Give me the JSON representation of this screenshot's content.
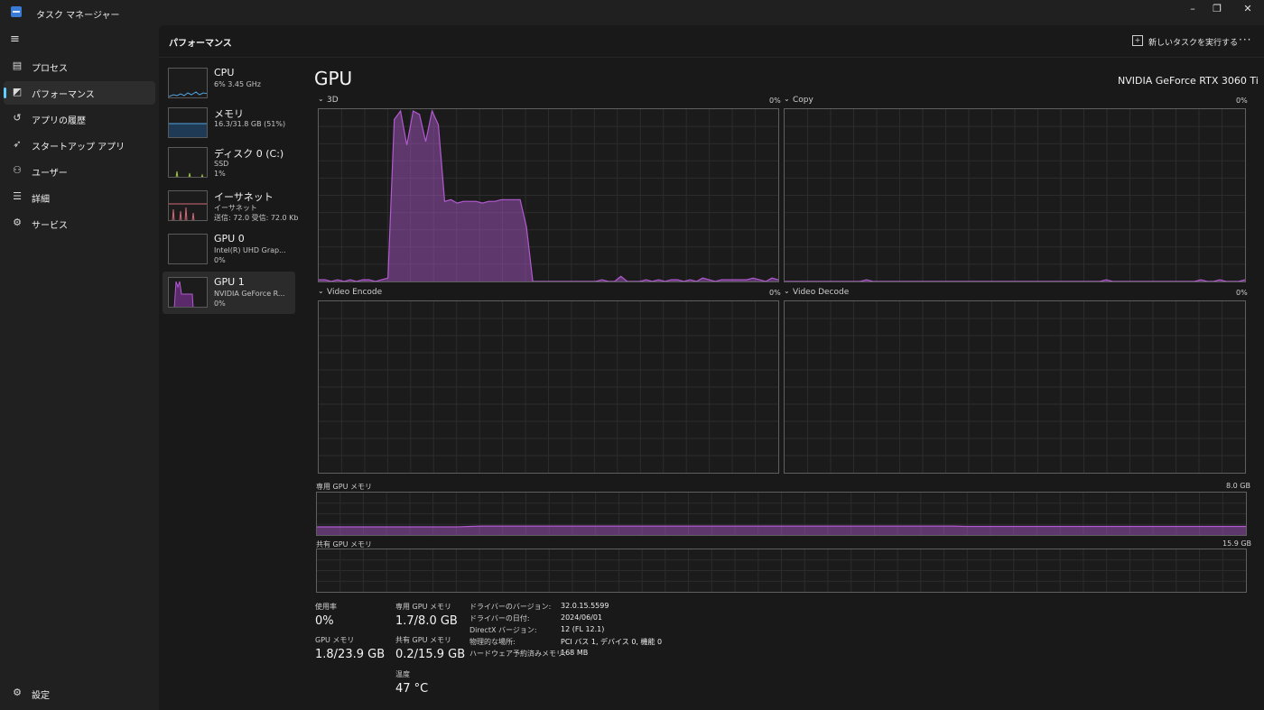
{
  "window": {
    "title": "タスク マネージャー",
    "controls": {
      "minimize": "–",
      "maximize": "❐",
      "close": "✕"
    }
  },
  "sidebar": {
    "items": [
      {
        "label": "プロセス",
        "icon": "process-icon"
      },
      {
        "label": "パフォーマンス",
        "icon": "performance-icon",
        "active": true
      },
      {
        "label": "アプリの履歴",
        "icon": "history-icon"
      },
      {
        "label": "スタートアップ アプリ",
        "icon": "startup-icon"
      },
      {
        "label": "ユーザー",
        "icon": "users-icon"
      },
      {
        "label": "詳細",
        "icon": "details-icon"
      },
      {
        "label": "サービス",
        "icon": "services-icon"
      }
    ],
    "settings_label": "設定"
  },
  "header": {
    "title": "パフォーマンス",
    "run_task_label": "新しいタスクを実行する",
    "more_label": "···"
  },
  "devices": [
    {
      "name": "CPU",
      "sub1": "6%  3.45 GHz",
      "sub2": "",
      "color": "#4fa3e0"
    },
    {
      "name": "メモリ",
      "sub1": "16.3/31.8 GB (51%)",
      "sub2": "",
      "color": "#4fa3e0"
    },
    {
      "name": "ディスク 0 (C:)",
      "sub1": "SSD",
      "sub2": "1%",
      "color": "#9bc93b"
    },
    {
      "name": "イーサネット",
      "sub1": "イーサネット",
      "sub2": "送信: 72.0  受信: 72.0 Kb",
      "color": "#d46a7a"
    },
    {
      "name": "GPU 0",
      "sub1": "Intel(R) UHD Grap...",
      "sub2": "0%",
      "color": "#b25ad1"
    },
    {
      "name": "GPU 1",
      "sub1": "NVIDIA GeForce R...",
      "sub2": "0%",
      "color": "#b25ad1",
      "active": true
    }
  ],
  "gpu": {
    "title": "GPU",
    "model": "NVIDIA GeForce RTX 3060 Ti",
    "accent": "#b25ad1",
    "engines": [
      {
        "label": "3D",
        "pct": "0%"
      },
      {
        "label": "Copy",
        "pct": "0%"
      },
      {
        "label": "Video Encode",
        "pct": "0%"
      },
      {
        "label": "Video Decode",
        "pct": "0%"
      }
    ],
    "dedicated_label": "専用 GPU メモリ",
    "dedicated_max": "8.0 GB",
    "shared_label": "共有 GPU メモリ",
    "shared_max": "15.9 GB"
  },
  "stats": {
    "usage_label": "使用率",
    "usage_value": "0%",
    "gpu_mem_label": "GPU メモリ",
    "gpu_mem_value": "1.8/23.9 GB",
    "dedicated_label": "専用 GPU メモリ",
    "dedicated_value": "1.7/8.0 GB",
    "shared_label": "共有 GPU メモリ",
    "shared_value": "0.2/15.9 GB",
    "temp_label": "温度",
    "temp_value": "47 °C"
  },
  "details": [
    {
      "key": "ドライバーのバージョン:",
      "value": "32.0.15.5599"
    },
    {
      "key": "ドライバーの日付:",
      "value": "2024/06/01"
    },
    {
      "key": "DirectX バージョン:",
      "value": "12 (FL 12.1)"
    },
    {
      "key": "物理的な場所:",
      "value": "PCI バス 1, デバイス 0, 機能 0"
    },
    {
      "key": "ハードウェア予約済みメモリ:",
      "value": "168 MB"
    }
  ],
  "usage_3d_history": [
    1,
    1,
    0,
    1,
    0,
    1,
    0,
    1,
    1,
    0,
    1,
    2,
    95,
    100,
    80,
    100,
    98,
    82,
    100,
    92,
    47,
    48,
    46,
    47,
    47,
    47,
    46,
    47,
    47,
    48,
    48,
    48,
    48,
    32,
    0,
    0,
    0,
    0,
    0,
    0,
    0,
    0,
    0,
    0,
    0,
    1,
    0,
    0,
    3,
    0,
    0,
    0,
    1,
    0,
    1,
    0,
    1,
    1,
    0,
    1,
    0,
    2,
    1,
    0,
    1,
    1,
    1,
    1,
    1,
    2,
    1,
    0,
    2,
    1
  ],
  "usage_copy_history": [
    0,
    0,
    0,
    0,
    0,
    0,
    0,
    0,
    0,
    0,
    0,
    0,
    0,
    1,
    0,
    0,
    0,
    0,
    0,
    0,
    0,
    0,
    0,
    0,
    0,
    0,
    0,
    0,
    0,
    0,
    0,
    0,
    0,
    0,
    0,
    0,
    0,
    0,
    0,
    0,
    0,
    0,
    0,
    0,
    0,
    0,
    0,
    0,
    0,
    0,
    0,
    1,
    0,
    0,
    0,
    0,
    0,
    0,
    0,
    0,
    0,
    0,
    0,
    0,
    0,
    0,
    1,
    0,
    0,
    1,
    0,
    0,
    0,
    1
  ],
  "dedicated_mem_history": [
    20,
    20,
    20,
    20,
    20,
    20,
    20,
    20,
    20,
    20,
    20,
    20,
    21,
    22,
    22,
    22,
    22,
    22,
    22,
    22,
    22,
    22,
    22,
    22,
    22,
    22,
    22,
    22,
    22,
    22,
    22,
    22,
    22,
    22,
    22,
    22,
    22,
    22,
    22,
    22,
    22,
    22,
    22,
    22,
    22,
    22,
    22,
    22,
    22,
    22,
    22,
    21,
    21,
    21,
    21,
    21,
    21,
    21,
    21,
    21,
    21,
    21,
    21,
    21,
    21,
    21,
    21,
    21,
    21,
    21,
    21,
    21,
    21,
    21
  ]
}
